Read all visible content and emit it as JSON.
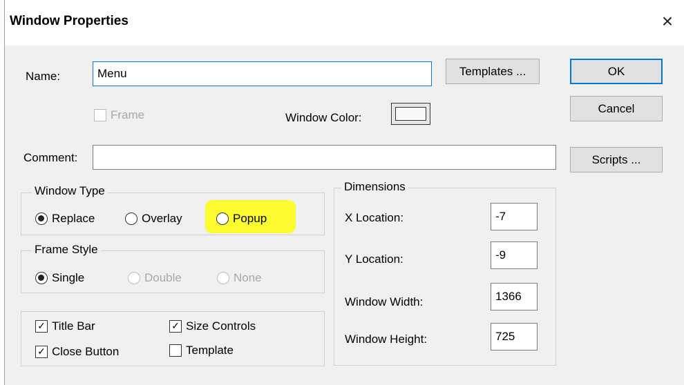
{
  "window": {
    "title": "Window Properties",
    "close_label": "×"
  },
  "name_field": {
    "label": "Name:",
    "value": "Menu"
  },
  "frame_checkbox": {
    "label": "Frame",
    "checked": false,
    "enabled": false
  },
  "window_color": {
    "label": "Window Color:"
  },
  "comment_field": {
    "label": "Comment:",
    "value": ""
  },
  "buttons": {
    "templates": "Templates ...",
    "ok": "OK",
    "cancel": "Cancel",
    "scripts": "Scripts ..."
  },
  "window_type": {
    "title": "Window Type",
    "options": [
      {
        "label": "Replace",
        "selected": true
      },
      {
        "label": "Overlay",
        "selected": false
      },
      {
        "label": "Popup",
        "selected": false,
        "highlighted": true
      }
    ]
  },
  "frame_style": {
    "title": "Frame Style",
    "options": [
      {
        "label": "Single",
        "selected": true,
        "enabled": true
      },
      {
        "label": "Double",
        "selected": false,
        "enabled": false
      },
      {
        "label": "None",
        "selected": false,
        "enabled": false
      }
    ]
  },
  "options": {
    "title_bar": {
      "label": "Title Bar",
      "checked": true
    },
    "size_controls": {
      "label": "Size Controls",
      "checked": true
    },
    "close_button": {
      "label": "Close Button",
      "checked": true
    },
    "template": {
      "label": "Template",
      "checked": false
    }
  },
  "dimensions": {
    "title": "Dimensions",
    "x_location": {
      "label": "X Location:",
      "value": "-7"
    },
    "y_location": {
      "label": "Y Location:",
      "value": "-9"
    },
    "window_width": {
      "label": "Window Width:",
      "value": "1366"
    },
    "window_height": {
      "label": "Window Height:",
      "value": "725"
    }
  },
  "colors": {
    "highlight": "#ffff00",
    "focus_border": "#0078d7"
  }
}
